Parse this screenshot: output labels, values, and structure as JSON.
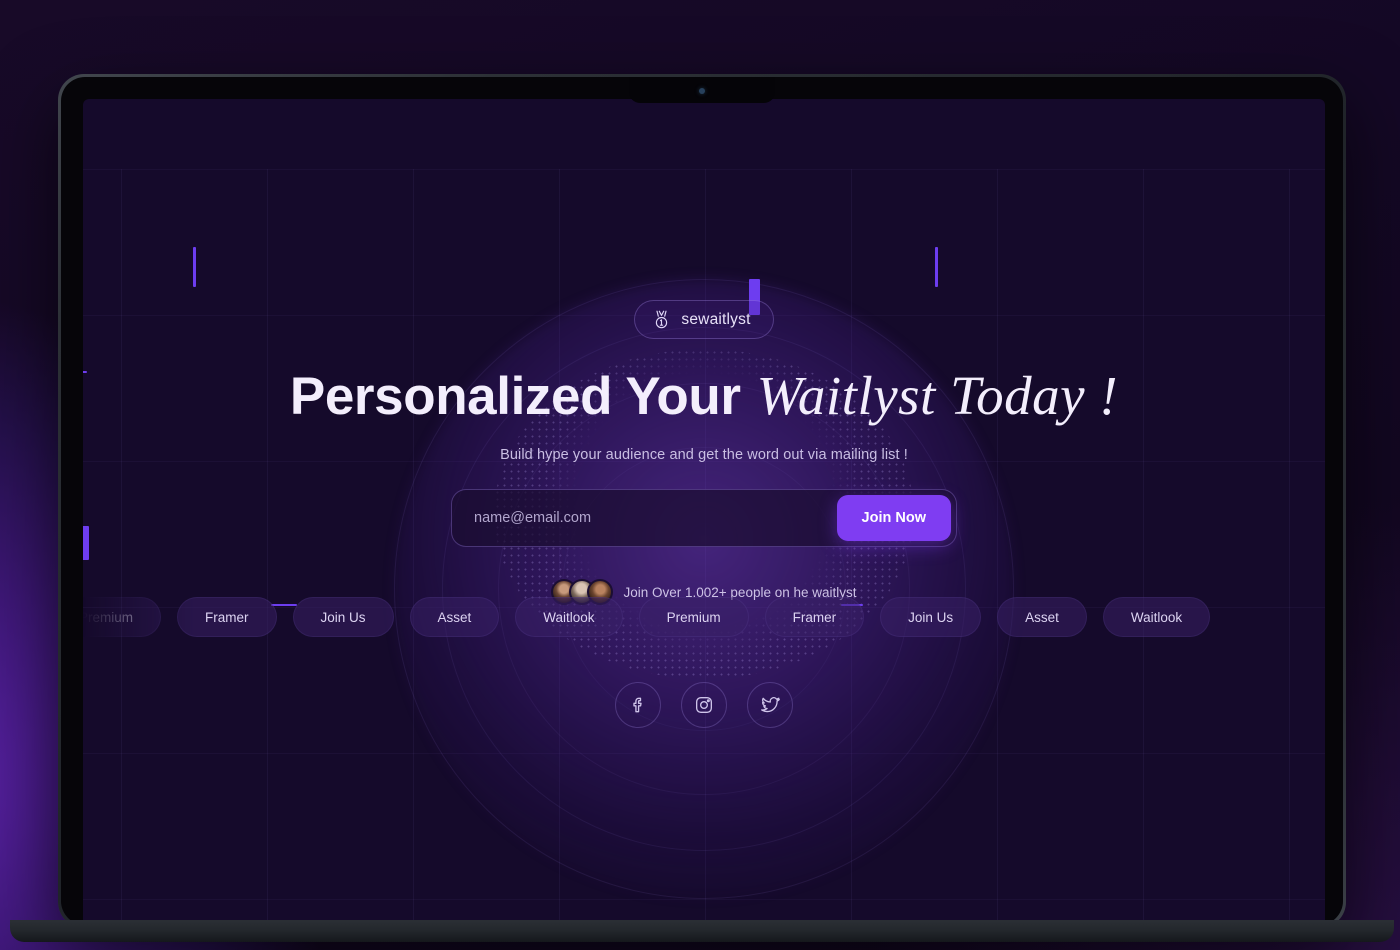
{
  "site": {
    "badge": {
      "label": "sewaitlyst",
      "icon": "medal-icon"
    },
    "headline": {
      "plain": "Personalized Your",
      "italic": "Waitlyst Today !"
    },
    "subheadline": "Build hype your audience and get the word out via mailing list !",
    "form": {
      "email_placeholder": "name@email.com",
      "email_value": "",
      "submit_label": "Join Now"
    },
    "social_proof": {
      "text": "Join Over 1.002+ people on he waitlyst",
      "avatar_count": 3
    },
    "marquee_pills": [
      "Premium",
      "Framer",
      "Join Us",
      "Asset",
      "Waitlook",
      "Premium",
      "Framer",
      "Join Us",
      "Asset",
      "Waitlook"
    ],
    "socials": [
      {
        "name": "facebook-icon",
        "label": "Facebook"
      },
      {
        "name": "instagram-icon",
        "label": "Instagram"
      },
      {
        "name": "twitter-icon",
        "label": "Twitter"
      }
    ]
  },
  "colors": {
    "accent": "#7f3df2",
    "accent_bar": "#6d3df0",
    "screen_bg": "#150a2b",
    "text_primary": "#f3eefc",
    "text_muted": "#c9bee3"
  },
  "device": {
    "type": "laptop",
    "has_notch": true,
    "camera": "camera-dot"
  }
}
